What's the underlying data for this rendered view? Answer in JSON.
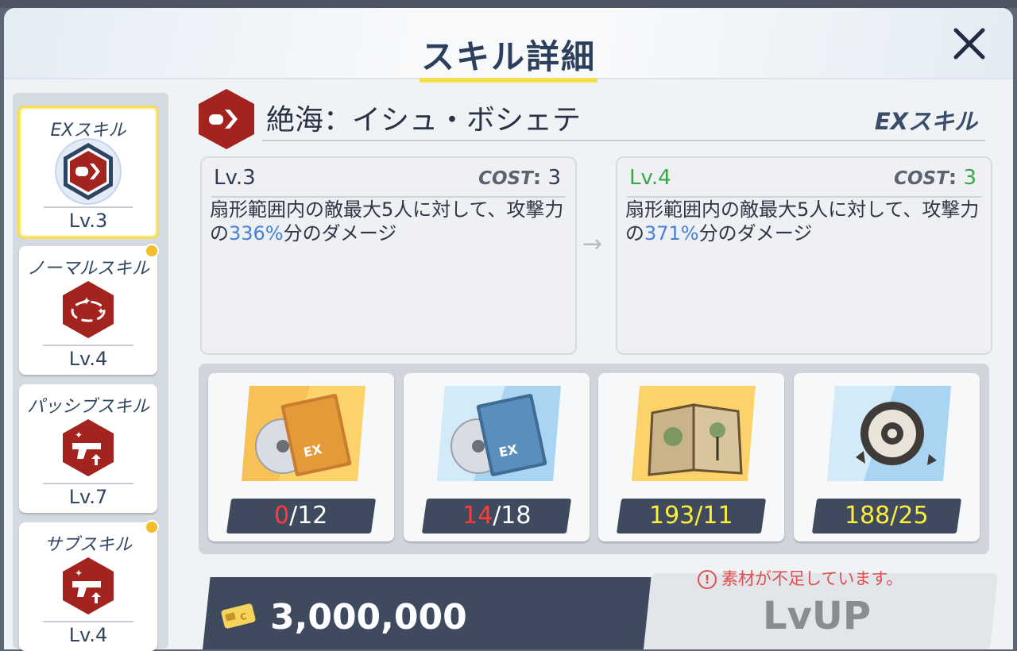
{
  "header": {
    "title": "スキル詳細"
  },
  "sidebar": {
    "tabs": [
      {
        "name": "EXスキル",
        "level": "Lv.3",
        "icon": "ex-skill-bullet-icon",
        "active": true,
        "badge": false
      },
      {
        "name": "ノーマルスキル",
        "level": "Lv.4",
        "icon": "orbit-stars-icon",
        "active": false,
        "badge": true
      },
      {
        "name": "パッシブスキル",
        "level": "Lv.7",
        "icon": "pistol-up-icon",
        "active": false,
        "badge": false
      },
      {
        "name": "サブスキル",
        "level": "Lv.4",
        "icon": "pistol-up-icon",
        "active": false,
        "badge": true
      }
    ]
  },
  "skill": {
    "name": "絶海：イシュ・ボシェテ",
    "type": "EXスキル",
    "current": {
      "level": "Lv.3",
      "cost_label": "COST",
      "cost_sep": ":",
      "cost": "3",
      "desc_pre": "扇形範囲内の敵最大5人に対して、攻撃力の",
      "desc_pct": "336%",
      "desc_post": "分のダメージ"
    },
    "next": {
      "level": "Lv.4",
      "cost_label": "COST",
      "cost_sep": ":",
      "cost": "3",
      "desc_pre": "扇形範囲内の敵最大5人に対して、攻撃力の",
      "desc_pct": "371%",
      "desc_post": "分のダメージ"
    },
    "arrow": "→"
  },
  "materials": [
    {
      "icon": "ex-tech-notes-gehenna-tier3-icon",
      "owned": "0",
      "sep": "/",
      "required": "12",
      "short": true
    },
    {
      "icon": "ex-tech-notes-gehenna-tier2-icon",
      "owned": "14",
      "sep": "/",
      "required": "18",
      "short": true
    },
    {
      "icon": "ancient-book-artifact-icon",
      "owned": "193",
      "sep": "/",
      "required": "11",
      "short": false
    },
    {
      "icon": "mechanism-gear-artifact-icon",
      "owned": "188",
      "sep": "/",
      "required": "25",
      "short": false
    }
  ],
  "footer": {
    "credit_icon": "credit-card-icon",
    "credits": "3,000,000",
    "lvup_label": "LvUP",
    "warning_icon": "!",
    "warning": "素材が不足しています。"
  },
  "colors": {
    "accent_yellow": "#f4e04a",
    "skill_red": "#a3231f",
    "next_level_green": "#3aa84a",
    "shortage_red": "#ff3a3a",
    "enough_yellow": "#fcef3c"
  }
}
